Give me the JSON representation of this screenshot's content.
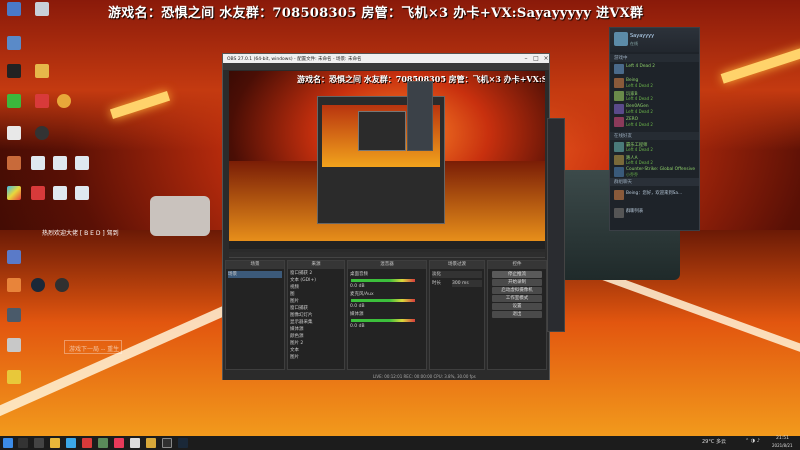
{
  "banner": {
    "text": "游戏名：恐惧之间 水友群：708508305   房管：飞机×3    办卡+VX:Sayayyyyy 进VX群"
  },
  "desktop": {
    "qq_label": "热烈欢迎大佬 [ B E D ] 驾到",
    "faint_box": "游戏下一局 -- 重生"
  },
  "obs": {
    "title": "OBS 27.0.1 (64-bit, windows) - 配置文件: 未命名 - 场景: 未命名",
    "preview_banner": "游戏名：恐惧之间 水友群：708508305   房管：飞机×3    办卡+VX:Sayayyyyy 进VX群",
    "panel_titles": [
      "场景",
      "来源",
      "混音器",
      "场景过渡",
      "控件"
    ],
    "scenes": [
      "场景"
    ],
    "sources": [
      "窗口捕获 2",
      "文本 (GDI+)",
      "视频",
      "图",
      "图片",
      "窗口捕获",
      "图像幻灯片",
      "显示器采集",
      "媒体源",
      "颜色源",
      "图片 2",
      "文本",
      "图片"
    ],
    "mixer": [
      {
        "name": "桌面音频",
        "level": "0.0 dB"
      },
      {
        "name": "麦克风/Aux",
        "level": "0.0 dB"
      },
      {
        "name": "媒体源",
        "level": "0.0 dB"
      }
    ],
    "transition": {
      "type": "淡化",
      "duration_label": "时长",
      "duration": "300 ms"
    },
    "controls": [
      "停止推流",
      "开始录制",
      "启动虚拟摄像机",
      "工作室模式",
      "设置",
      "退出"
    ],
    "status": "LIVE: 00:12:01    REC: 00:00:00    CPU: 3.8%, 30.00 fps"
  },
  "steam": {
    "user_name": "Sayayyyy",
    "user_status": "在线",
    "groups": [
      "游戏中",
      "在线好友"
    ],
    "friends": [
      {
        "name": "Left 4 Dead 2",
        "game": "",
        "color": "#4a6a8a"
      },
      {
        "name": "Being",
        "game": "Left 4 Dead 2",
        "color": "#8a5a3a"
      },
      {
        "name": "玩家B",
        "game": "Left 4 Dead 2",
        "color": "#6a8a4a"
      },
      {
        "name": "Ben0AGen",
        "game": "Left 4 Dead 2",
        "color": "#5a4a8a"
      },
      {
        "name": "ZERO",
        "game": "Left 4 Dead 2",
        "color": "#8a3a5a"
      },
      {
        "name": "霸乐工程师",
        "game": "Left 4 Dead 2",
        "color": "#4a7a7a"
      },
      {
        "name": "路人A",
        "game": "Left 4 Dead 2",
        "color": "#7a6a3a"
      },
      {
        "name": "Counter-Strike: Global Offensive",
        "game": "",
        "color": "#3a5a7a"
      },
      {
        "name": "小乔乔",
        "game": "",
        "color": "#6a4a4a"
      }
    ],
    "chat_header": "群组聊天",
    "chat_preview": "Being：您好，欢迎来到Sa...",
    "chat_footer": "群聊列表"
  },
  "taskbar": {
    "weather": "29°C 多云",
    "time": "21:51",
    "date": "2021/8/21"
  }
}
